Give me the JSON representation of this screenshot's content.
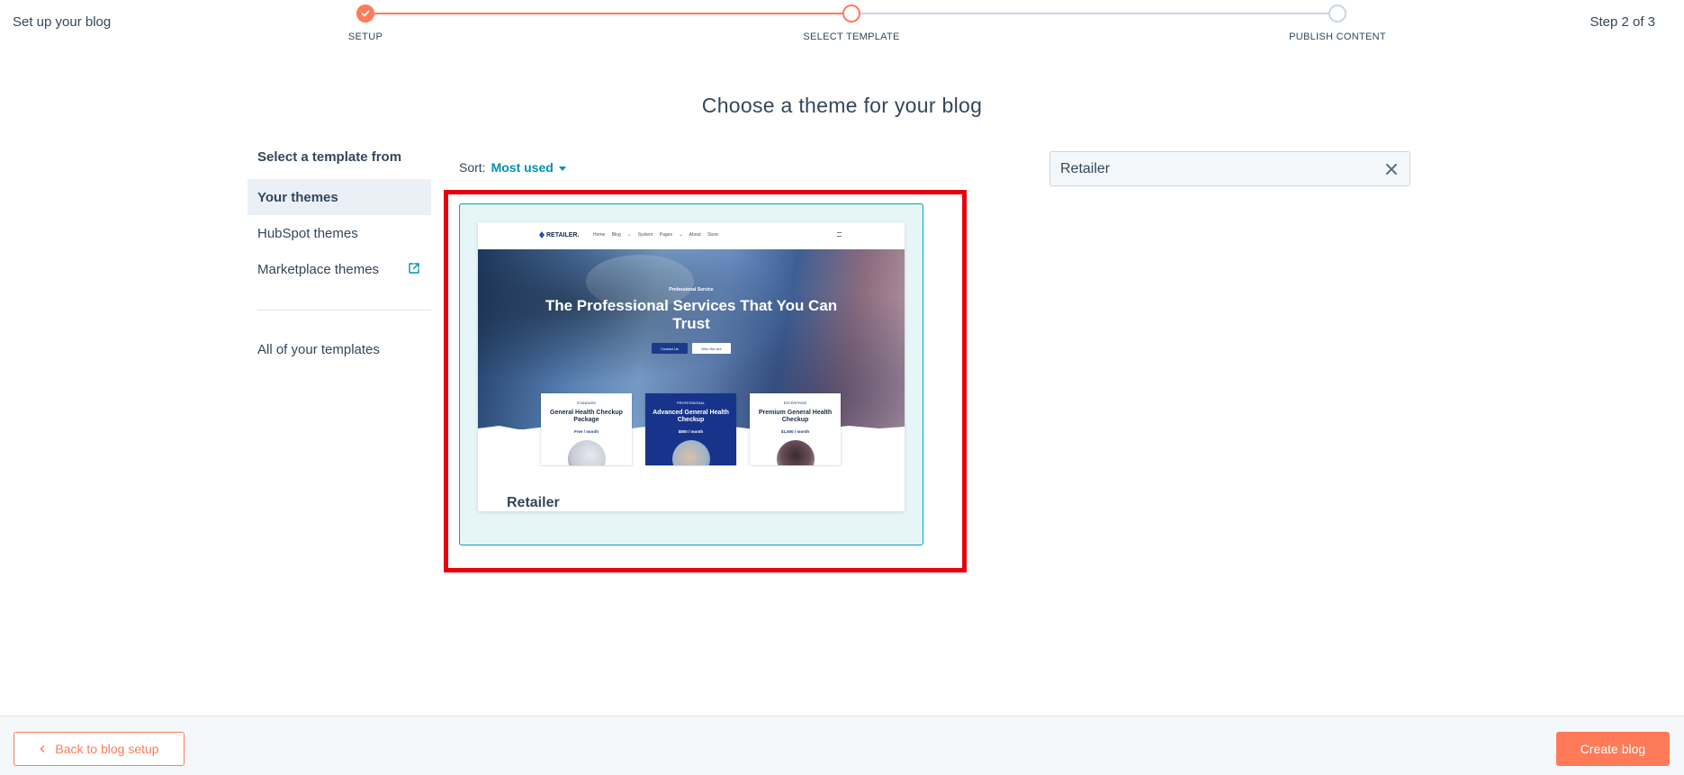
{
  "header": {
    "title": "Set up your blog",
    "step_indicator": "Step 2 of 3",
    "steps": [
      {
        "label": "SETUP",
        "state": "complete"
      },
      {
        "label": "SELECT TEMPLATE",
        "state": "current"
      },
      {
        "label": "PUBLISH CONTENT",
        "state": "upcoming"
      }
    ]
  },
  "page": {
    "title": "Choose a theme for your blog"
  },
  "sidebar": {
    "heading": "Select a template from",
    "items": [
      {
        "label": "Your themes",
        "active": true
      },
      {
        "label": "HubSpot themes",
        "active": false
      },
      {
        "label": "Marketplace themes",
        "active": false,
        "icon": "external-link-icon"
      },
      {
        "label": "All of your templates",
        "active": false
      }
    ]
  },
  "sort": {
    "label": "Sort:",
    "value": "Most used"
  },
  "search": {
    "value": "Retailer"
  },
  "themes": [
    {
      "name": "Retailer",
      "selected": true,
      "preview": {
        "logo": "RETAILER.",
        "nav_links": "Home Blog ⌄ System Pages ⌄ About Store",
        "kicker": "Professional Service",
        "headline": "The Professional Services That You Can Trust",
        "buttons": [
          "Contact Us",
          "Who We Are"
        ],
        "plans": [
          {
            "tier": "STANDARD",
            "name": "General Health Checkup Package",
            "price": "Free / month"
          },
          {
            "tier": "PROFESSIONAL",
            "name": "Advanced General Health Checkup",
            "price": "$800 / month"
          },
          {
            "tier": "ENTERPRISE",
            "name": "Premium General Health Checkup",
            "price": "$1,500 / month"
          }
        ]
      }
    }
  ],
  "footer": {
    "back_label": "Back to blog setup",
    "create_label": "Create blog"
  },
  "colors": {
    "accent": "#ff7a59",
    "link": "#0091ae",
    "selected_card_bg": "#e5f5f8",
    "selected_card_border": "#00a4bd",
    "highlight": "#e8000b"
  }
}
